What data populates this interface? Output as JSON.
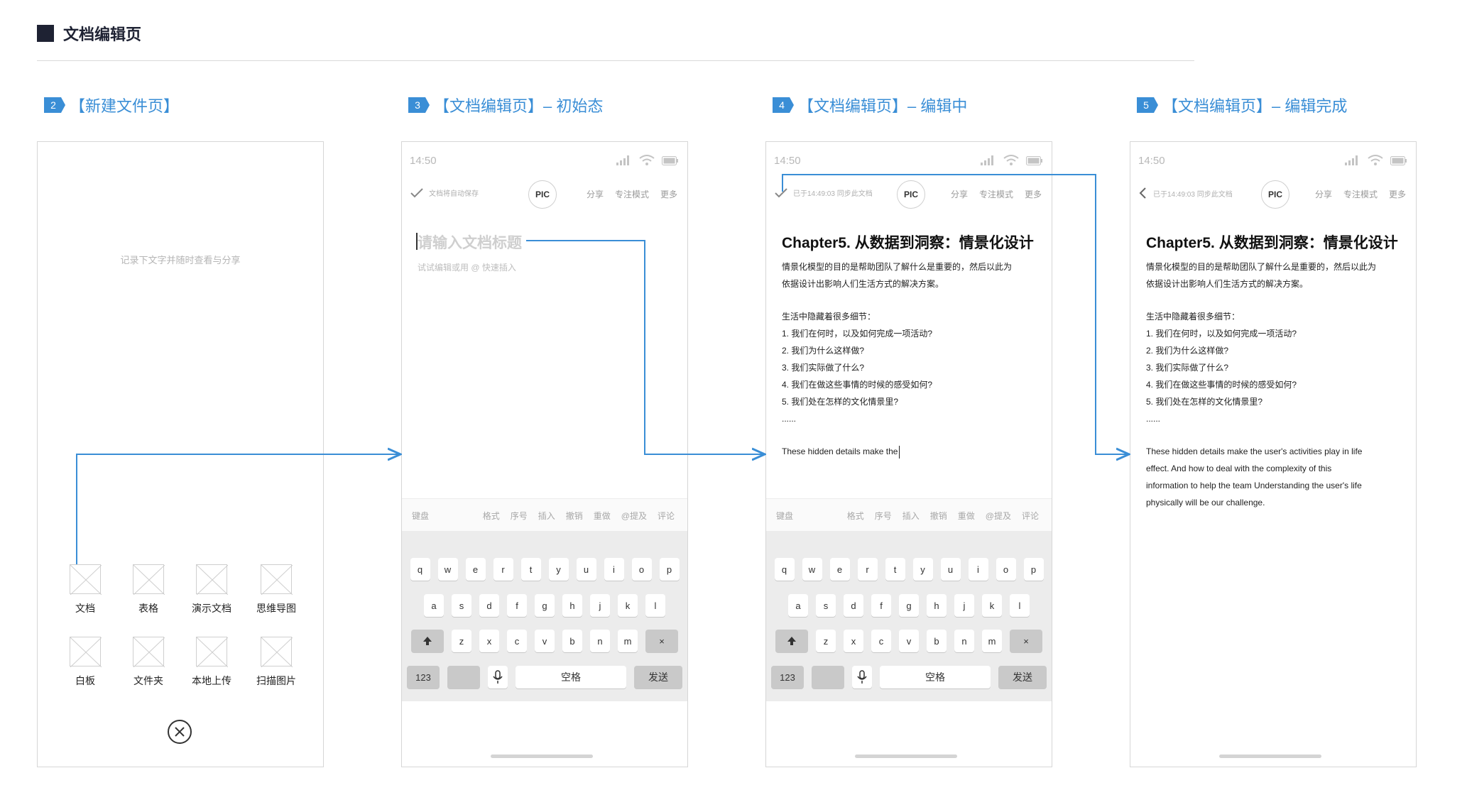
{
  "header": {
    "title": "文档编辑页"
  },
  "steps": [
    {
      "num": "2",
      "label": "【新建文件页】"
    },
    {
      "num": "3",
      "label": "【文档编辑页】– 初始态"
    },
    {
      "num": "4",
      "label": "【文档编辑页】– 编辑中"
    },
    {
      "num": "5",
      "label": "【文档编辑页】– 编辑完成"
    }
  ],
  "colors": {
    "accent": "#3a8ed6",
    "header_square": "#1e2233"
  },
  "newfile": {
    "hint": "记录下文字并随时查看与分享",
    "items": [
      "文档",
      "表格",
      "演示文档",
      "思维导图",
      "白板",
      "文件夹",
      "本地上传",
      "扫描图片"
    ],
    "close_icon": "close-circle-icon"
  },
  "status": {
    "time": "14:50"
  },
  "toolbar": {
    "pic": "PIC",
    "share": "分享",
    "focus": "专注模式",
    "more": "更多",
    "autosave": "文档将自动保存",
    "synced": "已于14:49:03 同步此文档"
  },
  "editor_initial": {
    "title_placeholder": "请输入文档标题",
    "hint": "试试编辑或用 @ 快速插入"
  },
  "doc": {
    "title": "Chapter5. 从数据到洞察：情景化设计",
    "para1_line1": "情景化模型的目的是帮助团队了解什么是重要的，然后以此为",
    "para1_line2": "依据设计出影响人们生活方式的解决方案。",
    "list_title": "生活中隐藏着很多细节：",
    "items": [
      "1. 我们在何时，以及如何完成一项活动?",
      "2. 我们为什么这样做?",
      "3. 我们实际做了什么?",
      "4. 我们在做这些事情的时候的感受如何?",
      "5. 我们处在怎样的文化情景里?"
    ],
    "ellipsis": "......",
    "typing": "These hidden details make the",
    "final_lines": [
      "These hidden details make the user's activities play in life",
      "effect. And how to deal with the complexity of this",
      "information to help the team Understanding the user's life",
      "physically will be our challenge."
    ]
  },
  "keyboard": {
    "tools_left": "键盘",
    "tools": [
      "格式",
      "序号",
      "插入",
      "撤销",
      "重做",
      "@提及",
      "评论"
    ],
    "row1": [
      "q",
      "w",
      "e",
      "r",
      "t",
      "y",
      "u",
      "i",
      "o",
      "p"
    ],
    "row2": [
      "a",
      "s",
      "d",
      "f",
      "g",
      "h",
      "j",
      "k",
      "l"
    ],
    "row3": [
      "z",
      "x",
      "c",
      "v",
      "b",
      "n",
      "m"
    ],
    "delete": "×",
    "num": "123",
    "space": "空格",
    "send": "发送"
  }
}
